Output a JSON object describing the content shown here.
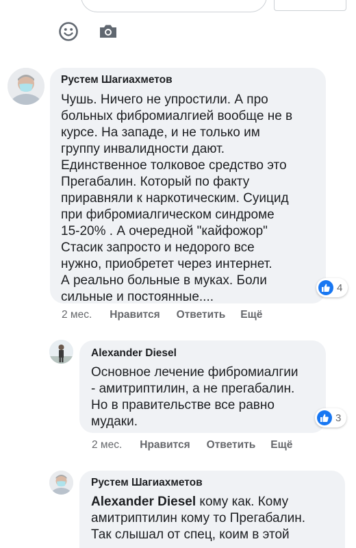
{
  "composer": {
    "emoji_icon": "emoji-icon",
    "camera_icon": "camera-icon"
  },
  "colors": {
    "bubble": "#f0f2f5",
    "like": "#1877f2",
    "meta_text": "#65676b"
  },
  "comments": [
    {
      "author": "Рустем Шагиахметов",
      "text": "Чушь. Ничего не упростили. А про\nбольных фибромиалгией вообще не в\nкурсе. На западе, и не только им\nгруппу инвалидности дают.\nЕдинственное толковое средство это\nПрегабалин. Который по факту\nприравняли к наркотическим. Суицид\nпри фибромиалгическом синдроме\n15-20% . А очередной \"кайфожор\"\nСтасик запросто и недорого все\nнужно, приобретет через интернет.\nА реально больные в муках. Боли\nсильные и постоянные....",
      "reactions": "4",
      "time": "2 мес.",
      "like_label": "Нравится",
      "reply_label": "Ответить",
      "more_label": "Ещё"
    },
    {
      "author": "Alexander Diesel",
      "text": "Основное лечение фибромиалгии\n- амитриптилин, а не прегабалин.\nНо в правительстве все равно\nмудаки.",
      "reactions": "3",
      "time": "2 мес.",
      "like_label": "Нравится",
      "reply_label": "Ответить",
      "more_label": "Ещё"
    },
    {
      "author": "Рустем Шагиахметов",
      "mention": "Alexander Diesel",
      "text_after_mention": " кому как. Кому\nамитриптилин кому то Прегабалин.\nТак слышал от спец, коим в этой"
    }
  ]
}
